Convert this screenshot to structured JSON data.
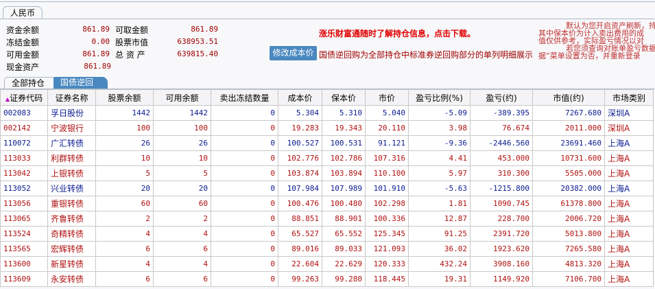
{
  "currency_tab": "人民币",
  "summary": [
    {
      "label": "资金余额",
      "value": "861.89"
    },
    {
      "label": "冻结金额",
      "value": "0.00"
    },
    {
      "label": "可用金额",
      "value": "861.89"
    },
    {
      "label": "现金资产",
      "value": "861.89"
    },
    {
      "label": "可取金额",
      "value": "861.89"
    },
    {
      "label": "股票市值",
      "value": "638953.51"
    },
    {
      "label": "总 资 产",
      "value": "639815.40"
    }
  ],
  "modify_cost_button": "修改成本价",
  "promo": "涨乐财富通随时了解持仓信息，点击下载。",
  "reverse_repo_note": "国债逆回购为全部持仓中标准券逆回购部分的单列明细展示",
  "notice_lines": [
    "默认为您开启资产刷新，持",
    "其中保本价为计入卖出费用的成",
    "值仅供参考，实际盈亏情况以对",
    "若您须查询对账单盈亏数据",
    "据”菜单设置为否，并重新登录"
  ],
  "position_tabs": [
    "全部持仓",
    "国债逆回购"
  ],
  "sort_indicator": "▲",
  "colors": {
    "gain": "#b01010",
    "loss": "#0a1a90",
    "accent": "#4a88c0"
  },
  "table": {
    "headers": [
      "证券代码",
      "证券名称",
      "股票余额",
      "可用余额",
      "卖出冻结数量",
      "成本价",
      "保本价",
      "市价",
      "盈亏比例(%)",
      "盈亏(约)",
      "市值(约)",
      "市场类别"
    ],
    "rows": [
      {
        "dir": "down",
        "cells": [
          "002083",
          "孚日股份",
          "1442",
          "1442",
          "0",
          "5.304",
          "5.310",
          "5.040",
          "-5.09",
          "-389.395",
          "7267.680",
          "深圳A"
        ]
      },
      {
        "dir": "up",
        "cells": [
          "002142",
          "宁波银行",
          "100",
          "100",
          "0",
          "19.283",
          "19.343",
          "20.110",
          "3.98",
          "76.674",
          "2011.000",
          "深圳A"
        ]
      },
      {
        "dir": "down",
        "cells": [
          "110072",
          "广汇转债",
          "26",
          "26",
          "0",
          "100.527",
          "100.531",
          "91.121",
          "-9.36",
          "-2446.560",
          "23691.460",
          "上海A"
        ]
      },
      {
        "dir": "up",
        "cells": [
          "113033",
          "利群转债",
          "10",
          "10",
          "0",
          "102.776",
          "102.786",
          "107.316",
          "4.41",
          "453.000",
          "10731.600",
          "上海A"
        ]
      },
      {
        "dir": "up",
        "cells": [
          "113042",
          "上银转债",
          "5",
          "5",
          "0",
          "103.874",
          "103.894",
          "110.100",
          "5.97",
          "310.300",
          "5505.000",
          "上海A"
        ]
      },
      {
        "dir": "down",
        "cells": [
          "113052",
          "兴业转债",
          "20",
          "20",
          "0",
          "107.984",
          "107.989",
          "101.910",
          "-5.63",
          "-1215.800",
          "20382.000",
          "上海A"
        ]
      },
      {
        "dir": "up",
        "cells": [
          "113056",
          "重银转债",
          "60",
          "60",
          "0",
          "100.476",
          "100.480",
          "102.298",
          "1.81",
          "1090.745",
          "61378.800",
          "上海A"
        ]
      },
      {
        "dir": "up",
        "cells": [
          "113065",
          "齐鲁转债",
          "2",
          "2",
          "0",
          "88.851",
          "88.901",
          "100.336",
          "12.87",
          "228.700",
          "2006.720",
          "上海A"
        ]
      },
      {
        "dir": "up",
        "cells": [
          "113524",
          "奇精转债",
          "4",
          "4",
          "0",
          "65.527",
          "65.552",
          "125.345",
          "91.25",
          "2391.720",
          "5013.800",
          "上海A"
        ]
      },
      {
        "dir": "up",
        "cells": [
          "113565",
          "宏辉转债",
          "6",
          "6",
          "0",
          "89.016",
          "89.033",
          "121.093",
          "36.02",
          "1923.620",
          "7265.580",
          "上海A"
        ]
      },
      {
        "dir": "up",
        "cells": [
          "113600",
          "新星转债",
          "4",
          "4",
          "0",
          "22.604",
          "22.629",
          "120.333",
          "432.24",
          "3908.160",
          "4813.320",
          "上海A"
        ]
      },
      {
        "dir": "up",
        "cells": [
          "113609",
          "永安转债",
          "6",
          "6",
          "0",
          "99.263",
          "99.280",
          "118.445",
          "19.31",
          "1149.920",
          "7106.700",
          "上海A"
        ]
      }
    ]
  }
}
